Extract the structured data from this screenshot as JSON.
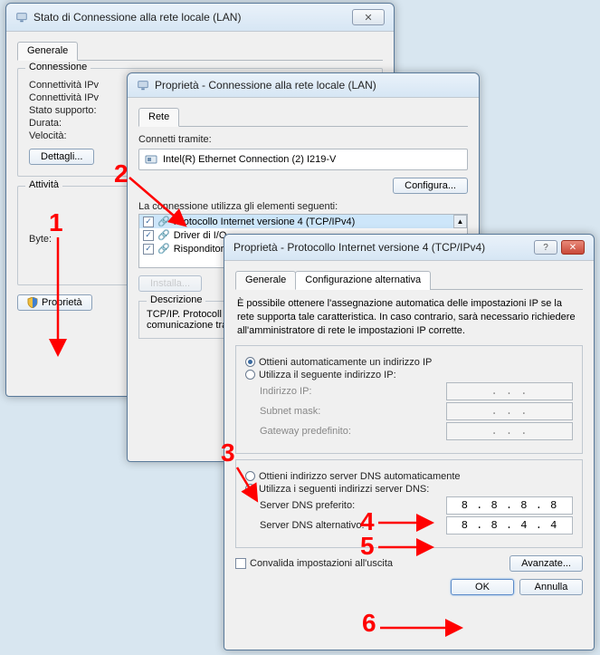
{
  "window1": {
    "title": "Stato di Connessione alla rete locale (LAN)",
    "tab_general": "Generale",
    "group_conn": "Connessione",
    "fields": {
      "connectivity4": "Connettività IPv",
      "connectivity6": "Connettività IPv",
      "media_state": "Stato supporto:",
      "duration": "Durata:",
      "speed": "Velocità:"
    },
    "btn_details": "Dettagli...",
    "group_activity": "Attività",
    "bytes_label": "Byte:",
    "btn_properties": "Proprietà"
  },
  "window2": {
    "title": "Proprietà - Connessione alla rete locale (LAN)",
    "tab_network": "Rete",
    "connect_using": "Connetti tramite:",
    "adapter": "Intel(R) Ethernet Connection (2) I219-V",
    "btn_configure": "Configura...",
    "items_label": "La connessione utilizza gli elementi seguenti:",
    "items": [
      "Protocollo Internet versione 4 (TCP/IPv4)",
      "Driver di I/O",
      "Risponditor"
    ],
    "btn_install": "Installa...",
    "desc_label": "Descrizione",
    "desc_text": "TCP/IP. Protocoll\ncomunicazione tra"
  },
  "window3": {
    "title": "Proprietà - Protocollo Internet versione 4 (TCP/IPv4)",
    "tab_general": "Generale",
    "tab_alt": "Configurazione alternativa",
    "intro": "È possibile ottenere l'assegnazione automatica delle impostazioni IP se la rete supporta tale caratteristica. In caso contrario, sarà necessario richiedere all'amministratore di rete le impostazioni IP corrette.",
    "radio_auto_ip": "Ottieni automaticamente un indirizzo IP",
    "radio_manual_ip": "Utilizza il seguente indirizzo IP:",
    "lbl_ip": "Indirizzo IP:",
    "lbl_subnet": "Subnet mask:",
    "lbl_gateway": "Gateway predefinito:",
    "radio_auto_dns": "Ottieni indirizzo server DNS automaticamente",
    "radio_manual_dns": "Utilizza i seguenti indirizzi server DNS:",
    "lbl_pref_dns": "Server DNS preferito:",
    "lbl_alt_dns": "Server DNS alternativo:",
    "val_pref_dns": "8 . 8 . 8 . 8",
    "val_alt_dns": "8 . 8 . 4 . 4",
    "empty_ip": ".       .       .",
    "chk_validate": "Convalida impostazioni all'uscita",
    "btn_advanced": "Avanzate...",
    "btn_ok": "OK",
    "btn_cancel": "Annulla"
  },
  "annotations": {
    "n1": "1",
    "n2": "2",
    "n3": "3",
    "n4": "4",
    "n5": "5",
    "n6": "6"
  }
}
